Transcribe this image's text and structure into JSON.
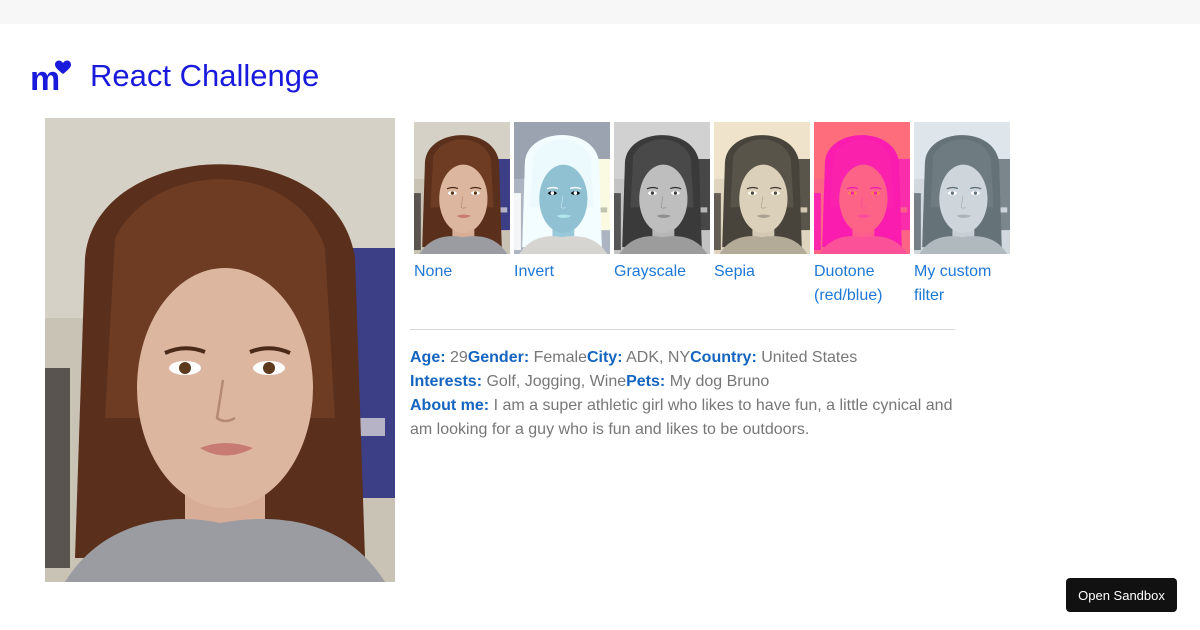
{
  "header": {
    "logo_letter": "m",
    "title": "React Challenge",
    "accent_color": "#1a1adc"
  },
  "profile_photo": {
    "icon": "portrait-photo"
  },
  "filters": [
    {
      "label": "None",
      "effect": "none"
    },
    {
      "label": "Invert",
      "effect": "invert"
    },
    {
      "label": "Grayscale",
      "effect": "grayscale"
    },
    {
      "label": "Sepia",
      "effect": "sepia"
    },
    {
      "label": "Duotone (red/blue)",
      "effect": "duotone"
    },
    {
      "label": "My custom filter",
      "effect": "custom"
    }
  ],
  "profile": {
    "age_label": "Age:",
    "age": "29",
    "gender_label": "Gender:",
    "gender": "Female",
    "city_label": "City:",
    "city": "ADK, NY",
    "country_label": "Country:",
    "country": "United States",
    "interests_label": "Interests:",
    "interests": "Golf, Jogging, Wine",
    "pets_label": "Pets:",
    "pets": "My dog Bruno",
    "about_label": "About me:",
    "about": "I am a super athletic girl who likes to have fun, a little cynical and am looking for a guy who is fun and likes to be outdoors."
  },
  "sandbox": {
    "label": "Open Sandbox"
  },
  "colors": {
    "link": "#1e78d6",
    "info_label": "#1565c0",
    "info_text": "#777777"
  }
}
